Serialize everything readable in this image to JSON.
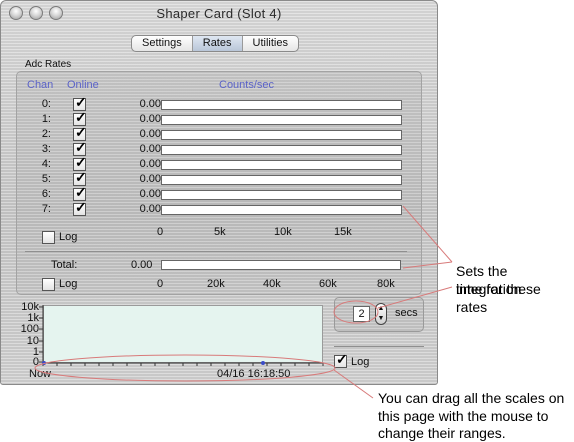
{
  "window": {
    "title": "Shaper Card (Slot 4)"
  },
  "tabs": [
    {
      "label": "Settings"
    },
    {
      "label": "Rates",
      "active": true
    },
    {
      "label": "Utilities"
    }
  ],
  "adc": {
    "group_label": "Adc Rates",
    "headers": {
      "chan": "Chan",
      "online": "Online",
      "counts": "Counts/sec"
    },
    "channels": [
      {
        "chan": "0:",
        "online": true,
        "value": "0.00"
      },
      {
        "chan": "1:",
        "online": true,
        "value": "0.00"
      },
      {
        "chan": "2:",
        "online": true,
        "value": "0.00"
      },
      {
        "chan": "3:",
        "online": true,
        "value": "0.00"
      },
      {
        "chan": "4:",
        "online": true,
        "value": "0.00"
      },
      {
        "chan": "5:",
        "online": true,
        "value": "0.00"
      },
      {
        "chan": "6:",
        "online": true,
        "value": "0.00"
      },
      {
        "chan": "7:",
        "online": true,
        "value": "0.00"
      }
    ],
    "scale_ticks": [
      "0",
      "5k",
      "10k",
      "15k"
    ],
    "log_label": "Log",
    "log_checked": false,
    "total_label": "Total:",
    "total_value": "0.00",
    "total_ticks": [
      "0",
      "20k",
      "40k",
      "60k",
      "80k"
    ],
    "total_log_label": "Log",
    "total_log_checked": false
  },
  "plot": {
    "y_ticks": [
      "10k",
      "1k",
      "100",
      "10",
      "1",
      "0"
    ],
    "x_left": "Now",
    "x_right": "04/16 16:18:50",
    "log_label": "Log",
    "log_checked": true
  },
  "integration": {
    "value": "2",
    "unit": "secs"
  },
  "annotations": {
    "rates_note_line1": "Sets the integration",
    "rates_note_line2": "time for these rates",
    "drag_note_line1": "You can drag all the scales on",
    "drag_note_line2": "this page with the mouse to",
    "drag_note_line3": "change their ranges."
  },
  "colors": {
    "header_text": "#5b63c8",
    "annotation_line": "#d87a7a",
    "plot_bg": "#e5f4ef"
  }
}
